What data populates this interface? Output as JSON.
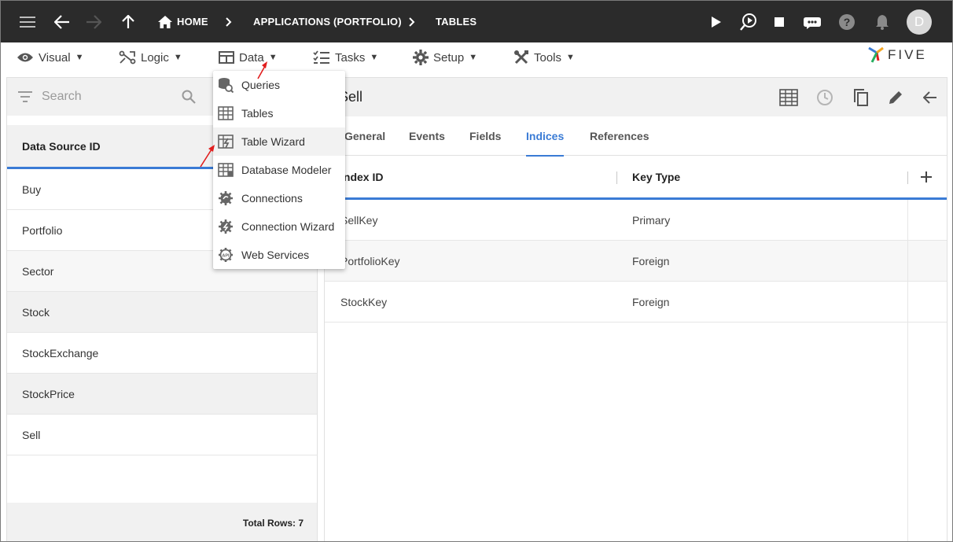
{
  "topbar": {
    "breadcrumbs": [
      "HOME",
      "APPLICATIONS (PORTFOLIO)",
      "TABLES"
    ],
    "avatar_initial": "D"
  },
  "menubar": {
    "items": [
      {
        "label": "Visual",
        "icon": "eye-icon"
      },
      {
        "label": "Logic",
        "icon": "logic-icon"
      },
      {
        "label": "Data",
        "icon": "table-icon"
      },
      {
        "label": "Tasks",
        "icon": "tasks-icon"
      },
      {
        "label": "Setup",
        "icon": "gear-icon"
      },
      {
        "label": "Tools",
        "icon": "tools-icon"
      }
    ],
    "logo_text": "FIVE"
  },
  "data_menu": {
    "items": [
      {
        "label": "Queries",
        "icon": "queries-icon"
      },
      {
        "label": "Tables",
        "icon": "tables-icon"
      },
      {
        "label": "Table Wizard",
        "icon": "table-wizard-icon"
      },
      {
        "label": "Database Modeler",
        "icon": "database-modeler-icon"
      },
      {
        "label": "Connections",
        "icon": "connections-icon"
      },
      {
        "label": "Connection Wizard",
        "icon": "connection-wizard-icon"
      },
      {
        "label": "Web Services",
        "icon": "web-services-icon"
      }
    ],
    "hovered": "Table Wizard"
  },
  "left_panel": {
    "search_placeholder": "Search",
    "column_header": "Data Source ID",
    "rows": [
      "Buy",
      "Portfolio",
      "Sector",
      "Stock",
      "StockExchange",
      "StockPrice",
      "Sell"
    ],
    "footer": "Total Rows: 7"
  },
  "right_panel": {
    "title": "Sell",
    "tabs": [
      "General",
      "Events",
      "Fields",
      "Indices",
      "References"
    ],
    "active_tab": "Indices",
    "columns": [
      "Index ID",
      "Key Type"
    ],
    "rows": [
      {
        "index_id": "SellKey",
        "key_type": "Primary"
      },
      {
        "index_id": "PortfolioKey",
        "key_type": "Foreign"
      },
      {
        "index_id": "StockKey",
        "key_type": "Foreign"
      }
    ]
  },
  "colors": {
    "topbar": "#2b2b2b",
    "accent": "#3a7bd5",
    "annotation_arrow": "#e11d1d"
  }
}
